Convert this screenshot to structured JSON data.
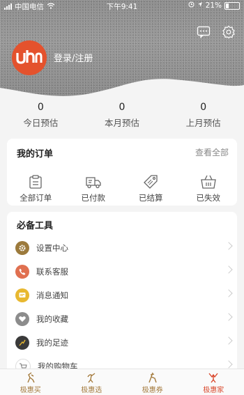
{
  "status_bar": {
    "carrier": "中国电信",
    "time": "下午9:41",
    "battery": "21%"
  },
  "header": {
    "avatar_text": "uhn",
    "login": "登录/注册"
  },
  "stats": [
    {
      "value": "0",
      "label": "今日预估"
    },
    {
      "value": "0",
      "label": "本月预估"
    },
    {
      "value": "0",
      "label": "上月预估"
    }
  ],
  "orders": {
    "title": "我的订单",
    "view_all": "查看全部",
    "items": [
      {
        "label": "全部订单",
        "icon": "clipboard-icon"
      },
      {
        "label": "已付款",
        "icon": "truck-icon"
      },
      {
        "label": "已结算",
        "icon": "tag-icon"
      },
      {
        "label": "已失效",
        "icon": "basket-icon"
      }
    ]
  },
  "tools": {
    "title": "必备工具",
    "items": [
      {
        "label": "设置中心",
        "icon": "gear-icon",
        "color": "#9c7a3c"
      },
      {
        "label": "联系客服",
        "icon": "phone-icon",
        "color": "#e07050"
      },
      {
        "label": "消息通知",
        "icon": "message-icon",
        "color": "#e8b830"
      },
      {
        "label": "我的收藏",
        "icon": "heart-icon",
        "color": "#8c8c8c"
      },
      {
        "label": "我的足迹",
        "icon": "footprint-icon",
        "color": "#3a3a3a"
      },
      {
        "label": "我的购物车",
        "icon": "cart-icon",
        "color": "#ffffff"
      }
    ]
  },
  "tabs": [
    {
      "label": "极惠买",
      "active": false
    },
    {
      "label": "极惠选",
      "active": false
    },
    {
      "label": "极惠券",
      "active": false
    },
    {
      "label": "极惠家",
      "active": true
    }
  ],
  "colors": {
    "accent": "#d9472b",
    "tab_inactive": "#a47a3c",
    "avatar_bg": "#e4522d"
  }
}
